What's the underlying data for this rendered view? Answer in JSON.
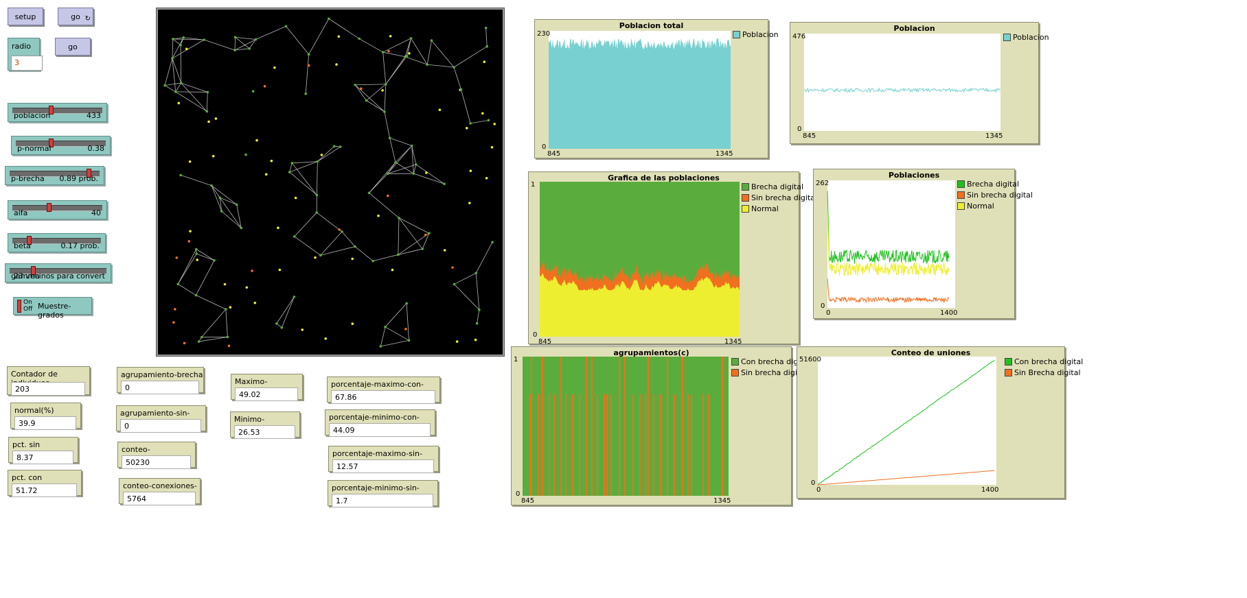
{
  "buttons": {
    "setup": "setup",
    "go_forever": "go",
    "go_once": "go"
  },
  "radio": {
    "label": "radio",
    "value": "3"
  },
  "sliders": [
    {
      "label": "poblacion",
      "value": "433",
      "fraction": 0.42
    },
    {
      "label": "p-normal",
      "value": "0.38",
      "fraction": 0.38
    },
    {
      "label": "p-brecha",
      "value": "0.89 prob.",
      "fraction": 0.89
    },
    {
      "label": "alfa",
      "value": "40",
      "fraction": 0.4
    },
    {
      "label": "beta",
      "value": "0.17 prob.",
      "fraction": 0.17
    },
    {
      "label": "gamma",
      "value": "23 vecinos para convert",
      "fraction": 0.23
    }
  ],
  "switch": {
    "label": "Muestre-grados",
    "on": "On",
    "off": "Off"
  },
  "monitors": [
    {
      "label": "Contador de individuos",
      "value": "203"
    },
    {
      "label": "normal(%)",
      "value": "39.9"
    },
    {
      "label": "pct. sin brecha(%)",
      "value": "8.37"
    },
    {
      "label": "pct. con brecha(%)",
      "value": "51.72"
    },
    {
      "label": "agrupamiento-brecha",
      "value": "0"
    },
    {
      "label": "agrupamiento-sin-brecha",
      "value": "0"
    },
    {
      "label": "conteo-conexiones-con",
      "value": "50230"
    },
    {
      "label": "conteo-conexiones-sin",
      "value": "5764"
    },
    {
      "label": "Maximo-normal(%)",
      "value": "49.02"
    },
    {
      "label": "Minimo-normal(%)",
      "value": "26.53"
    },
    {
      "label": "porcentaje-maximo-con-brecha",
      "value": "67.86"
    },
    {
      "label": "porcentaje-minimo-con-brecha",
      "value": "44.09"
    },
    {
      "label": "porcentaje-maximo-sin-brecha",
      "value": "12.57"
    },
    {
      "label": "porcentaje-minimo-sin-brecha",
      "value": "1.7"
    }
  ],
  "colors": {
    "green": "#5aad3c",
    "orange": "#f07020",
    "yellow": "#eeee30",
    "cyan": "#78d0d0",
    "line_green": "#20c020"
  },
  "chart_data": [
    {
      "type": "area",
      "title": "Poblacion total",
      "xlim": [
        845,
        1345
      ],
      "ylim": [
        0,
        230
      ],
      "x_ticks": [
        "845",
        "1345"
      ],
      "y_ticks": [
        "0",
        "230"
      ],
      "series": [
        {
          "name": "Poblacion",
          "color": "#78d0d0",
          "approx_mean": 200
        }
      ]
    },
    {
      "type": "line",
      "title": "Poblacion",
      "xlim": [
        845,
        1345
      ],
      "ylim": [
        0,
        476
      ],
      "x_ticks": [
        "845",
        "1345"
      ],
      "y_ticks": [
        "0",
        "476"
      ],
      "series": [
        {
          "name": "Poblacion",
          "color": "#78d0d0",
          "approx_mean": 200
        }
      ]
    },
    {
      "type": "area",
      "title": "Grafica de las poblaciones",
      "xlim": [
        845,
        1345
      ],
      "ylim": [
        0,
        1
      ],
      "x_ticks": [
        "845",
        "1345"
      ],
      "y_ticks": [
        "0",
        "1"
      ],
      "series": [
        {
          "name": "Brecha digital",
          "color": "#5aad3c"
        },
        {
          "name": "Sin brecha digital",
          "color": "#f07020"
        },
        {
          "name": "Normal",
          "color": "#eeee30",
          "approx_mean": 0.4
        }
      ]
    },
    {
      "type": "line",
      "title": "Poblaciones",
      "xlim": [
        0,
        1400
      ],
      "ylim": [
        0,
        262
      ],
      "x_ticks": [
        "0",
        "1400"
      ],
      "y_ticks": [
        "0",
        "262"
      ],
      "series": [
        {
          "name": "Brecha digital",
          "color": "#20c020",
          "approx_mean": 105
        },
        {
          "name": "Sin brecha digital",
          "color": "#f07020",
          "approx_mean": 17
        },
        {
          "name": "Normal",
          "color": "#eeee30",
          "approx_mean": 80
        }
      ]
    },
    {
      "type": "bar",
      "title": "agrupamientos(c)",
      "xlim": [
        845,
        1345
      ],
      "ylim": [
        0,
        1
      ],
      "x_ticks": [
        "845",
        "1345"
      ],
      "y_ticks": [
        "0",
        "1"
      ],
      "series": [
        {
          "name": "Con brecha digital",
          "color": "#5aad3c"
        },
        {
          "name": "Sin brecha digital",
          "color": "#f07020"
        }
      ]
    },
    {
      "type": "line",
      "title": "Conteo de uniones",
      "xlim": [
        0,
        1400
      ],
      "ylim": [
        0,
        51600
      ],
      "x_ticks": [
        "0",
        "1400"
      ],
      "y_ticks": [
        "0",
        "51600"
      ],
      "series": [
        {
          "name": "Con brecha digital",
          "color": "#20c020",
          "start": 0,
          "end": 50230
        },
        {
          "name": "Sin Brecha digital",
          "color": "#f07020",
          "start": 0,
          "end": 5764
        }
      ]
    }
  ]
}
